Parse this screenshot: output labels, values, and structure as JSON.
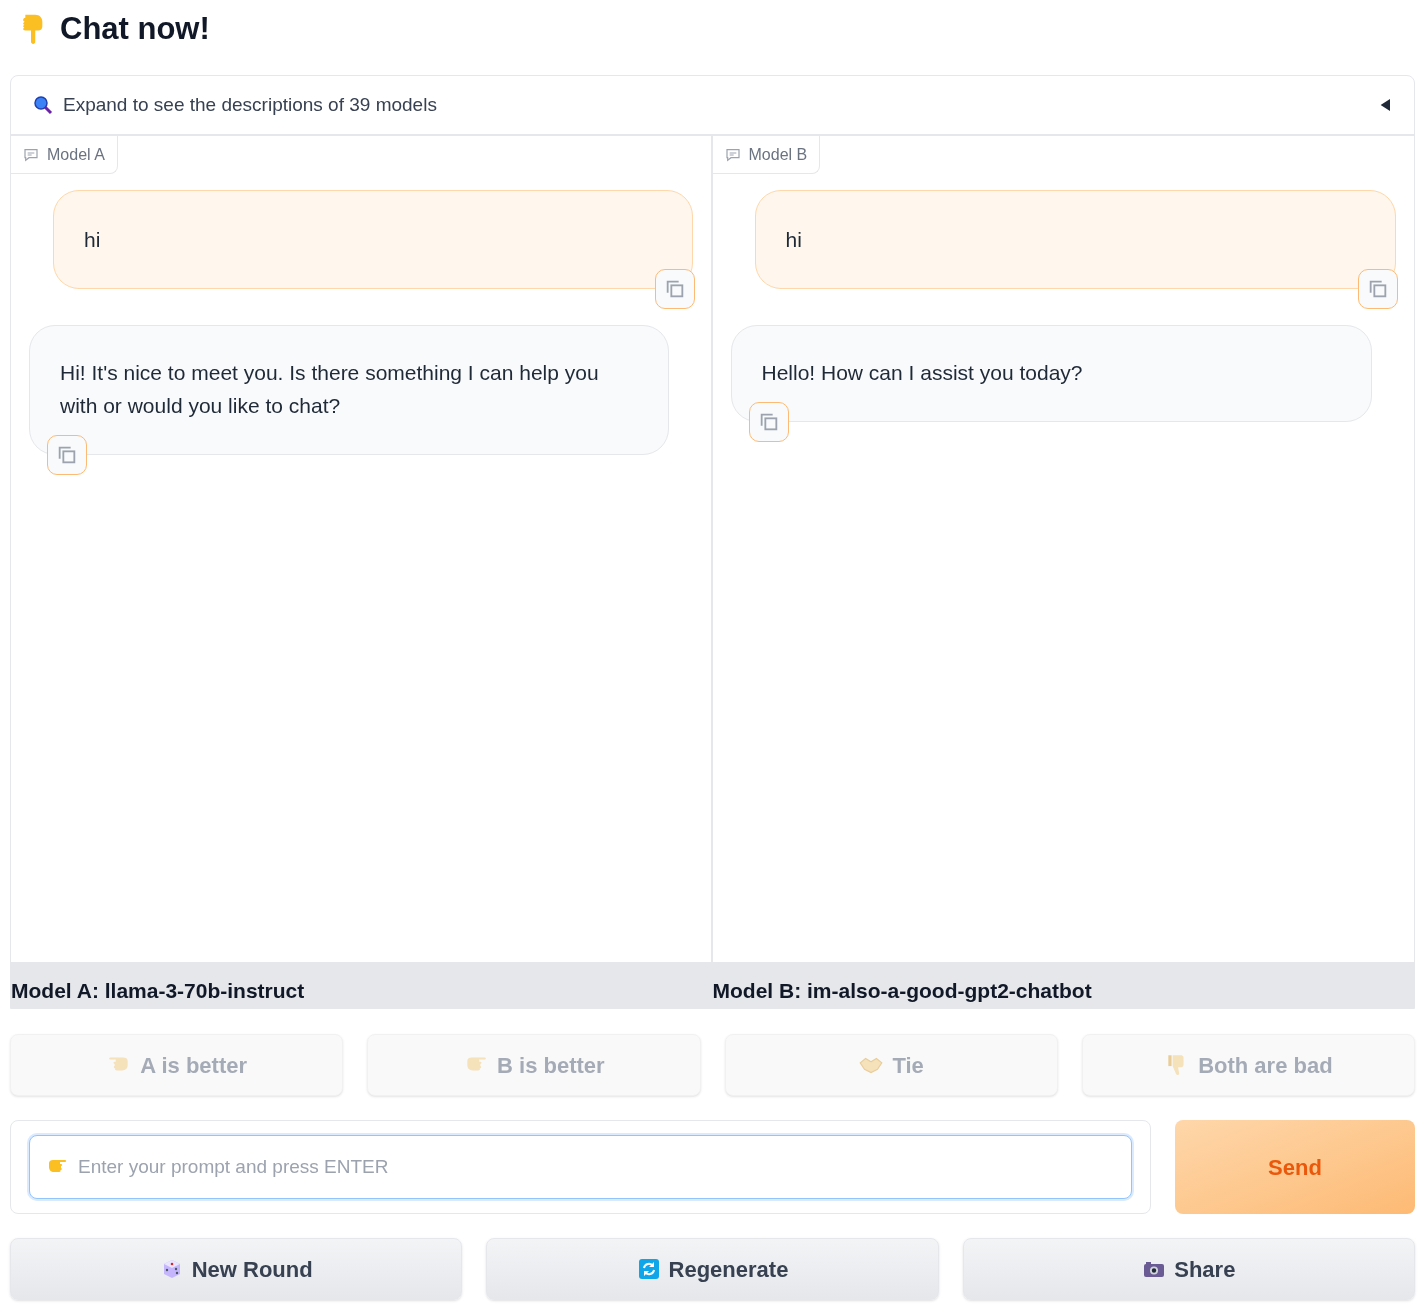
{
  "title": "Chat now!",
  "accordion": {
    "label": "Expand to see the descriptions of 39 models",
    "expanded": false
  },
  "panels": [
    {
      "tab": "Model A",
      "messages": [
        {
          "kind": "user",
          "text": "hi"
        },
        {
          "kind": "bot",
          "text": "Hi! It's nice to meet you. Is there something I can help you with or would you like to chat?"
        }
      ],
      "model_label": "Model A: llama-3-70b-instruct"
    },
    {
      "tab": "Model B",
      "messages": [
        {
          "kind": "user",
          "text": "hi"
        },
        {
          "kind": "bot",
          "text": "Hello! How can I assist you today?"
        }
      ],
      "model_label": "Model B: im-also-a-good-gpt2-chatbot"
    }
  ],
  "vote_buttons": [
    {
      "kind": "left",
      "label": "A is better",
      "disabled": true
    },
    {
      "kind": "right",
      "label": "B is better",
      "disabled": true
    },
    {
      "kind": "tie",
      "label": "Tie",
      "disabled": true
    },
    {
      "kind": "bad",
      "label": "Both are bad",
      "disabled": true
    }
  ],
  "prompt": {
    "placeholder": "Enter your prompt and press ENTER"
  },
  "send_button": "Send",
  "action_buttons": [
    {
      "kind": "dice",
      "label": "New Round"
    },
    {
      "kind": "refresh",
      "label": "Regenerate"
    },
    {
      "kind": "camera",
      "label": "Share"
    }
  ]
}
